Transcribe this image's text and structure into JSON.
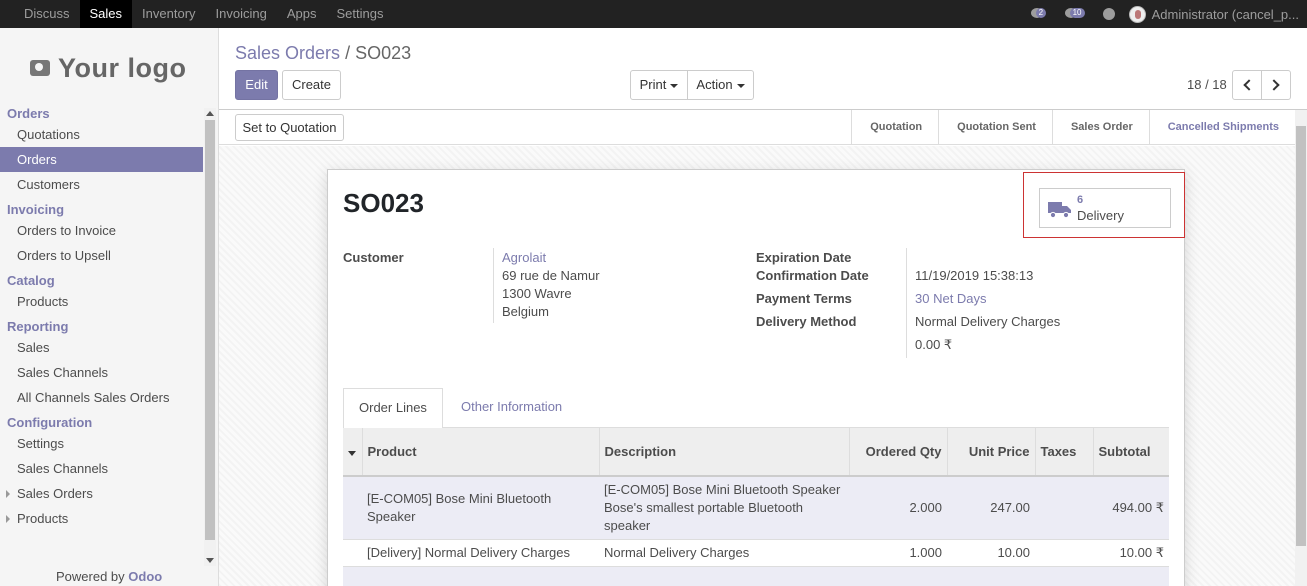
{
  "topbar": {
    "menu": [
      "Discuss",
      "Sales",
      "Inventory",
      "Invoicing",
      "Apps",
      "Settings"
    ],
    "active": "Sales",
    "chat_count": "2",
    "activity_count": "10",
    "user": "Administrator (cancel_p..."
  },
  "sidebar": {
    "logo_text": "Your logo",
    "sections": {
      "orders": "Orders",
      "invoicing": "Invoicing",
      "catalog": "Catalog",
      "reporting": "Reporting",
      "configuration": "Configuration"
    },
    "items": {
      "quotations": "Quotations",
      "orders": "Orders",
      "customers": "Customers",
      "orders_to_invoice": "Orders to Invoice",
      "orders_to_upsell": "Orders to Upsell",
      "products": "Products",
      "sales": "Sales",
      "sales_channels": "Sales Channels",
      "all_channels": "All Channels Sales Orders",
      "settings": "Settings",
      "config_sales_channels": "Sales Channels",
      "sales_orders": "Sales Orders",
      "config_products": "Products"
    },
    "powered_by": "Powered by",
    "powered_brand": "Odoo"
  },
  "control_panel": {
    "breadcrumb_parent": "Sales Orders",
    "breadcrumb_sep": "/",
    "breadcrumb_current": "SO023",
    "edit": "Edit",
    "create": "Create",
    "print": "Print",
    "action": "Action",
    "pager": "18 / 18"
  },
  "statusbar": {
    "set_to_quotation": "Set to Quotation",
    "stages": [
      "Quotation",
      "Quotation Sent",
      "Sales Order",
      "Cancelled Shipments"
    ],
    "active_stage": "Cancelled Shipments"
  },
  "form": {
    "title": "SO023",
    "delivery_count": "6",
    "delivery_label": "Delivery",
    "customer_label": "Customer",
    "customer_name": "Agrolait",
    "address": [
      "69 rue de Namur",
      "1300 Wavre",
      "Belgium"
    ],
    "expiration_label": "Expiration Date",
    "confirmation_label": "Confirmation Date",
    "confirmation_value": "11/19/2019 15:38:13",
    "payment_terms_label": "Payment Terms",
    "payment_terms_value": "30 Net Days",
    "delivery_method_label": "Delivery Method",
    "delivery_method_value": "Normal Delivery Charges",
    "delivery_amount": "0.00 ₹",
    "tabs": [
      "Order Lines",
      "Other Information"
    ]
  },
  "order_lines": {
    "headers": {
      "product": "Product",
      "description": "Description",
      "ordered_qty": "Ordered Qty",
      "unit_price": "Unit Price",
      "taxes": "Taxes",
      "subtotal": "Subtotal"
    },
    "rows": [
      {
        "product": "[E-COM05] Bose Mini Bluetooth Speaker",
        "description": "[E-COM05] Bose Mini Bluetooth Speaker Bose's smallest portable Bluetooth speaker",
        "qty": "2.000",
        "price": "247.00",
        "taxes": "",
        "subtotal": "494.00 ₹"
      },
      {
        "product": "[Delivery] Normal Delivery Charges",
        "description": "Normal Delivery Charges",
        "qty": "1.000",
        "price": "10.00",
        "taxes": "",
        "subtotal": "10.00 ₹"
      }
    ]
  }
}
